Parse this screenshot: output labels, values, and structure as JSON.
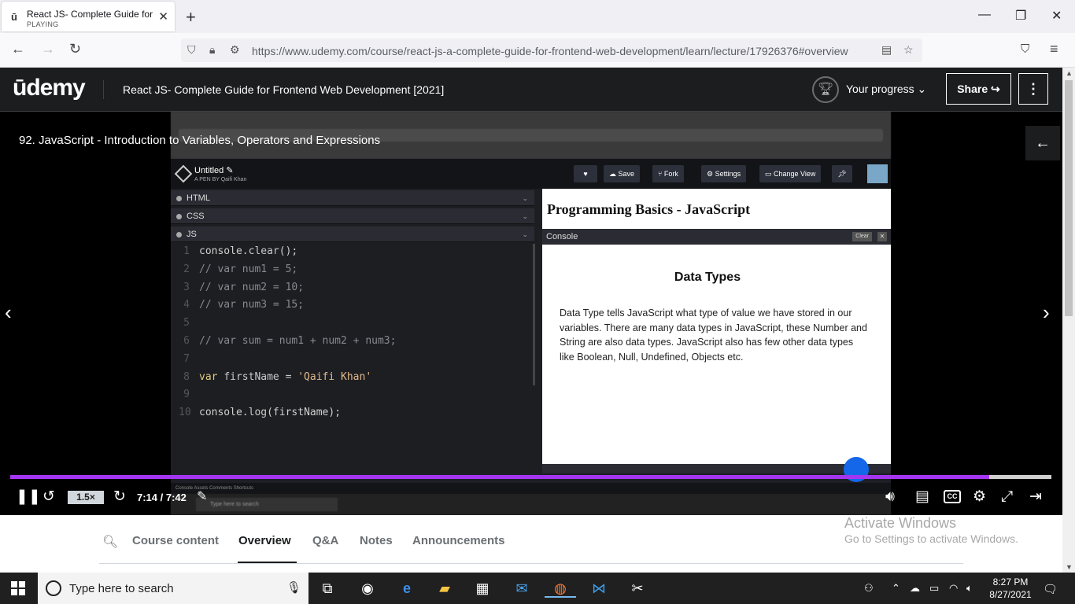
{
  "browser": {
    "tab_title": "React JS- Complete Guide for Fr",
    "tab_status": "PLAYING",
    "url_host": "https://www.udemy.com",
    "url_path": "/course/react-js-a-complete-guide-for-frontend-web-development/learn/lecture/17926376#overview"
  },
  "udemy": {
    "logo": "ūdemy",
    "course_title": "React JS- Complete Guide for Frontend Web Development [2021]",
    "progress_label": "Your progress",
    "share_label": "Share"
  },
  "video": {
    "lecture_title": "92. JavaScript - Introduction to Variables, Operators and Expressions",
    "speed": "1.5×",
    "time": "7:14 / 7:42",
    "progress_fraction": 0.94,
    "cc_label": "CC"
  },
  "recording": {
    "pen_title": "Untitled",
    "pen_by": "A PEN BY Qaifi Khan",
    "buttons": [
      "Save",
      "Fork",
      "Settings",
      "Change View"
    ],
    "panes": [
      "HTML",
      "CSS",
      "JS"
    ],
    "code_lines": [
      {
        "n": "1",
        "parts": [
          [
            "fn",
            "console."
          ],
          [
            "vr",
            "clear"
          ],
          [
            "fn",
            "();"
          ]
        ]
      },
      {
        "n": "2",
        "parts": [
          [
            "cm",
            "// var num1 = 5;"
          ]
        ]
      },
      {
        "n": "3",
        "parts": [
          [
            "cm",
            "// var num2 = 10;"
          ]
        ]
      },
      {
        "n": "4",
        "parts": [
          [
            "cm",
            "// var num3 = 15;"
          ]
        ]
      },
      {
        "n": "5",
        "parts": []
      },
      {
        "n": "6",
        "parts": [
          [
            "cm",
            "// var sum = num1 + num2 + num3;"
          ]
        ]
      },
      {
        "n": "7",
        "parts": []
      },
      {
        "n": "8",
        "parts": [
          [
            "kw",
            "var "
          ],
          [
            "vr",
            "firstName = "
          ],
          [
            "st",
            "'Qaifi Khan'"
          ]
        ]
      },
      {
        "n": "9",
        "parts": []
      },
      {
        "n": "10",
        "parts": [
          [
            "fn",
            "console."
          ],
          [
            "vr",
            "log"
          ],
          [
            "fn",
            "(firstName);"
          ]
        ]
      }
    ],
    "preview_title": "Programming Basics - JavaScript",
    "console_label": "Console",
    "clear_label": "Clear",
    "dt_title": "Data Types",
    "dt_body": "Data Type tells JavaScript what type of value we have stored in our variables. There are many data types in JavaScript, these Number and String are also data types. JavaScript also has few other data types like Boolean, Null, Undefined, Objects etc.",
    "footer_text": "Console   Assets   Comments   Shortcuts",
    "taskbar_search": "Type here to search"
  },
  "content_tabs": {
    "items": [
      "Course content",
      "Overview",
      "Q&A",
      "Notes",
      "Announcements"
    ],
    "active": "Overview"
  },
  "watermark": {
    "line1": "Activate Windows",
    "line2": "Go to Settings to activate Windows."
  },
  "taskbar": {
    "search_placeholder": "Type here to search",
    "time": "8:27 PM",
    "date": "8/27/2021"
  }
}
